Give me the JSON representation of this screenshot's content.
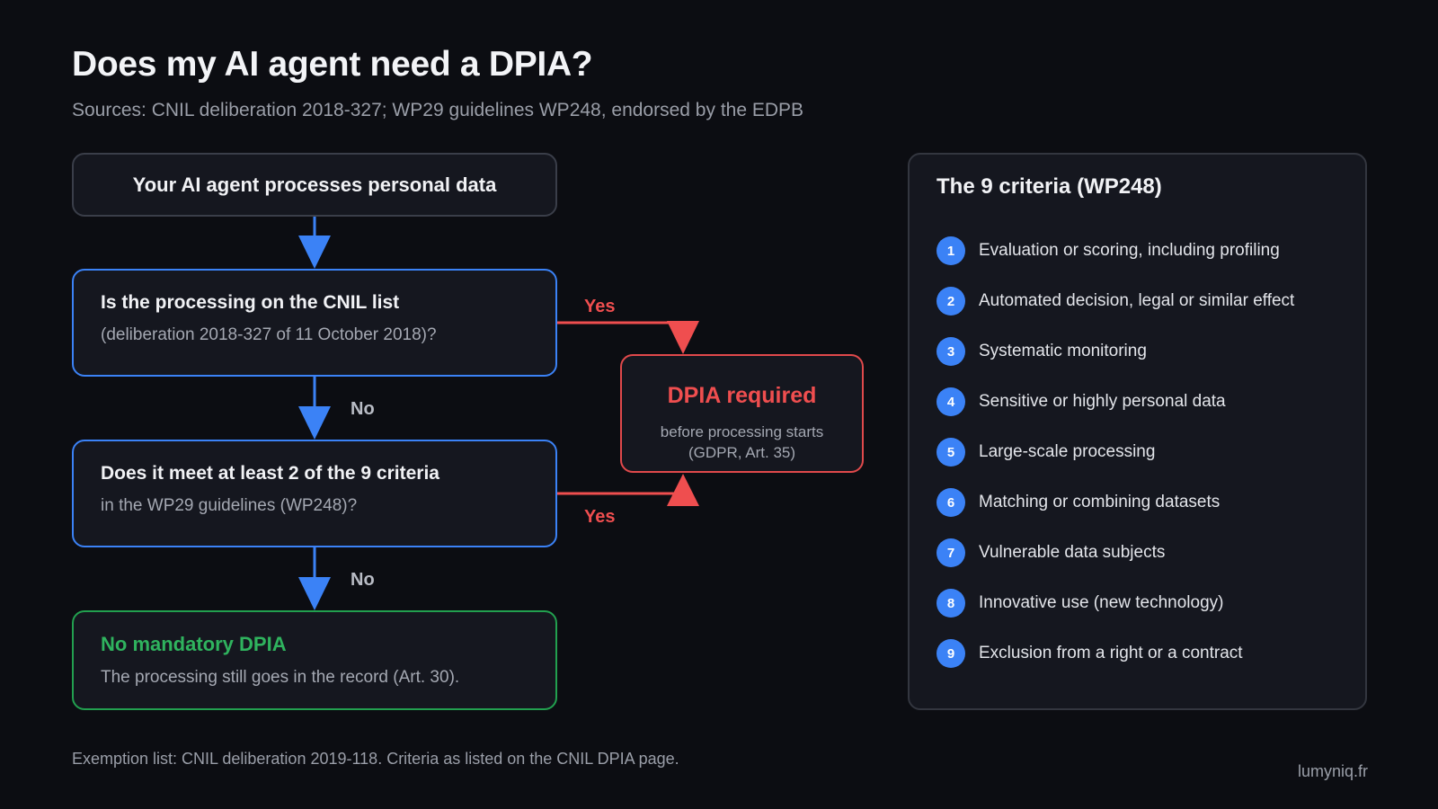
{
  "header": {
    "title": "Does my AI agent need a DPIA?",
    "subtitle": "Sources: CNIL deliberation 2018-327; WP29 guidelines WP248, endorsed by the EDPB"
  },
  "flow": {
    "start": "Your AI agent processes personal data",
    "q1": {
      "title": "Is the processing on the CNIL list",
      "detail": "(deliberation 2018-327 of 11 October 2018)?"
    },
    "q2": {
      "title": "Does it meet at least 2 of the 9 criteria",
      "detail": "in the WP29 guidelines (WP248)?"
    },
    "required": {
      "title": "DPIA required",
      "line1": "before processing starts",
      "line2": "(GDPR, Art. 35)"
    },
    "none": {
      "title": "No mandatory DPIA",
      "detail": "The processing still goes in the record (Art. 30)."
    },
    "labels": {
      "yes": "Yes",
      "no": "No"
    }
  },
  "criteria": {
    "title": "The 9 criteria (WP248)",
    "items": [
      {
        "num": "1",
        "label": "Evaluation or scoring, including profiling"
      },
      {
        "num": "2",
        "label": "Automated decision, legal or similar effect"
      },
      {
        "num": "3",
        "label": "Systematic monitoring"
      },
      {
        "num": "4",
        "label": "Sensitive or highly personal data"
      },
      {
        "num": "5",
        "label": "Large-scale processing"
      },
      {
        "num": "6",
        "label": "Matching or combining datasets"
      },
      {
        "num": "7",
        "label": "Vulnerable data subjects"
      },
      {
        "num": "8",
        "label": "Innovative use (new technology)"
      },
      {
        "num": "9",
        "label": "Exclusion from a right or a contract"
      }
    ]
  },
  "footer": {
    "note": "Exemption list: CNIL deliberation 2019-118. Criteria as listed on the CNIL DPIA page.",
    "brand": "lumyniq.fr"
  },
  "colors": {
    "background": "#0c0d12",
    "box": "#15171f",
    "blue": "#3b82f6",
    "red": "#ef4e4f",
    "green": "#2fb35e",
    "neutral_border": "#3a3e49"
  }
}
